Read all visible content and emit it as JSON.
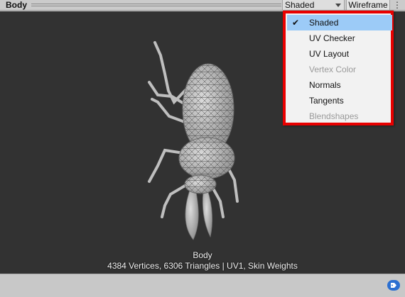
{
  "header": {
    "title": "Body",
    "shade_mode": "Shaded",
    "wireframe_label": "Wireframe",
    "more_glyph": "⋮"
  },
  "menu": {
    "items": [
      {
        "label": "Shaded",
        "checked": true,
        "enabled": true
      },
      {
        "label": "UV Checker",
        "checked": false,
        "enabled": true
      },
      {
        "label": "UV Layout",
        "checked": false,
        "enabled": true
      },
      {
        "label": "Vertex Color",
        "checked": false,
        "enabled": false
      },
      {
        "label": "Normals",
        "checked": false,
        "enabled": true
      },
      {
        "label": "Tangents",
        "checked": false,
        "enabled": true
      },
      {
        "label": "Blendshapes",
        "checked": false,
        "enabled": false
      }
    ],
    "check_glyph": "✔",
    "highlight_color": "#e80000"
  },
  "viewport": {
    "model_name": "Body",
    "stats": "4384 Vertices, 6306 Triangles | UV1, Skin Weights",
    "background": "#323232"
  },
  "footer": {
    "tag_icon": "tag-icon"
  }
}
